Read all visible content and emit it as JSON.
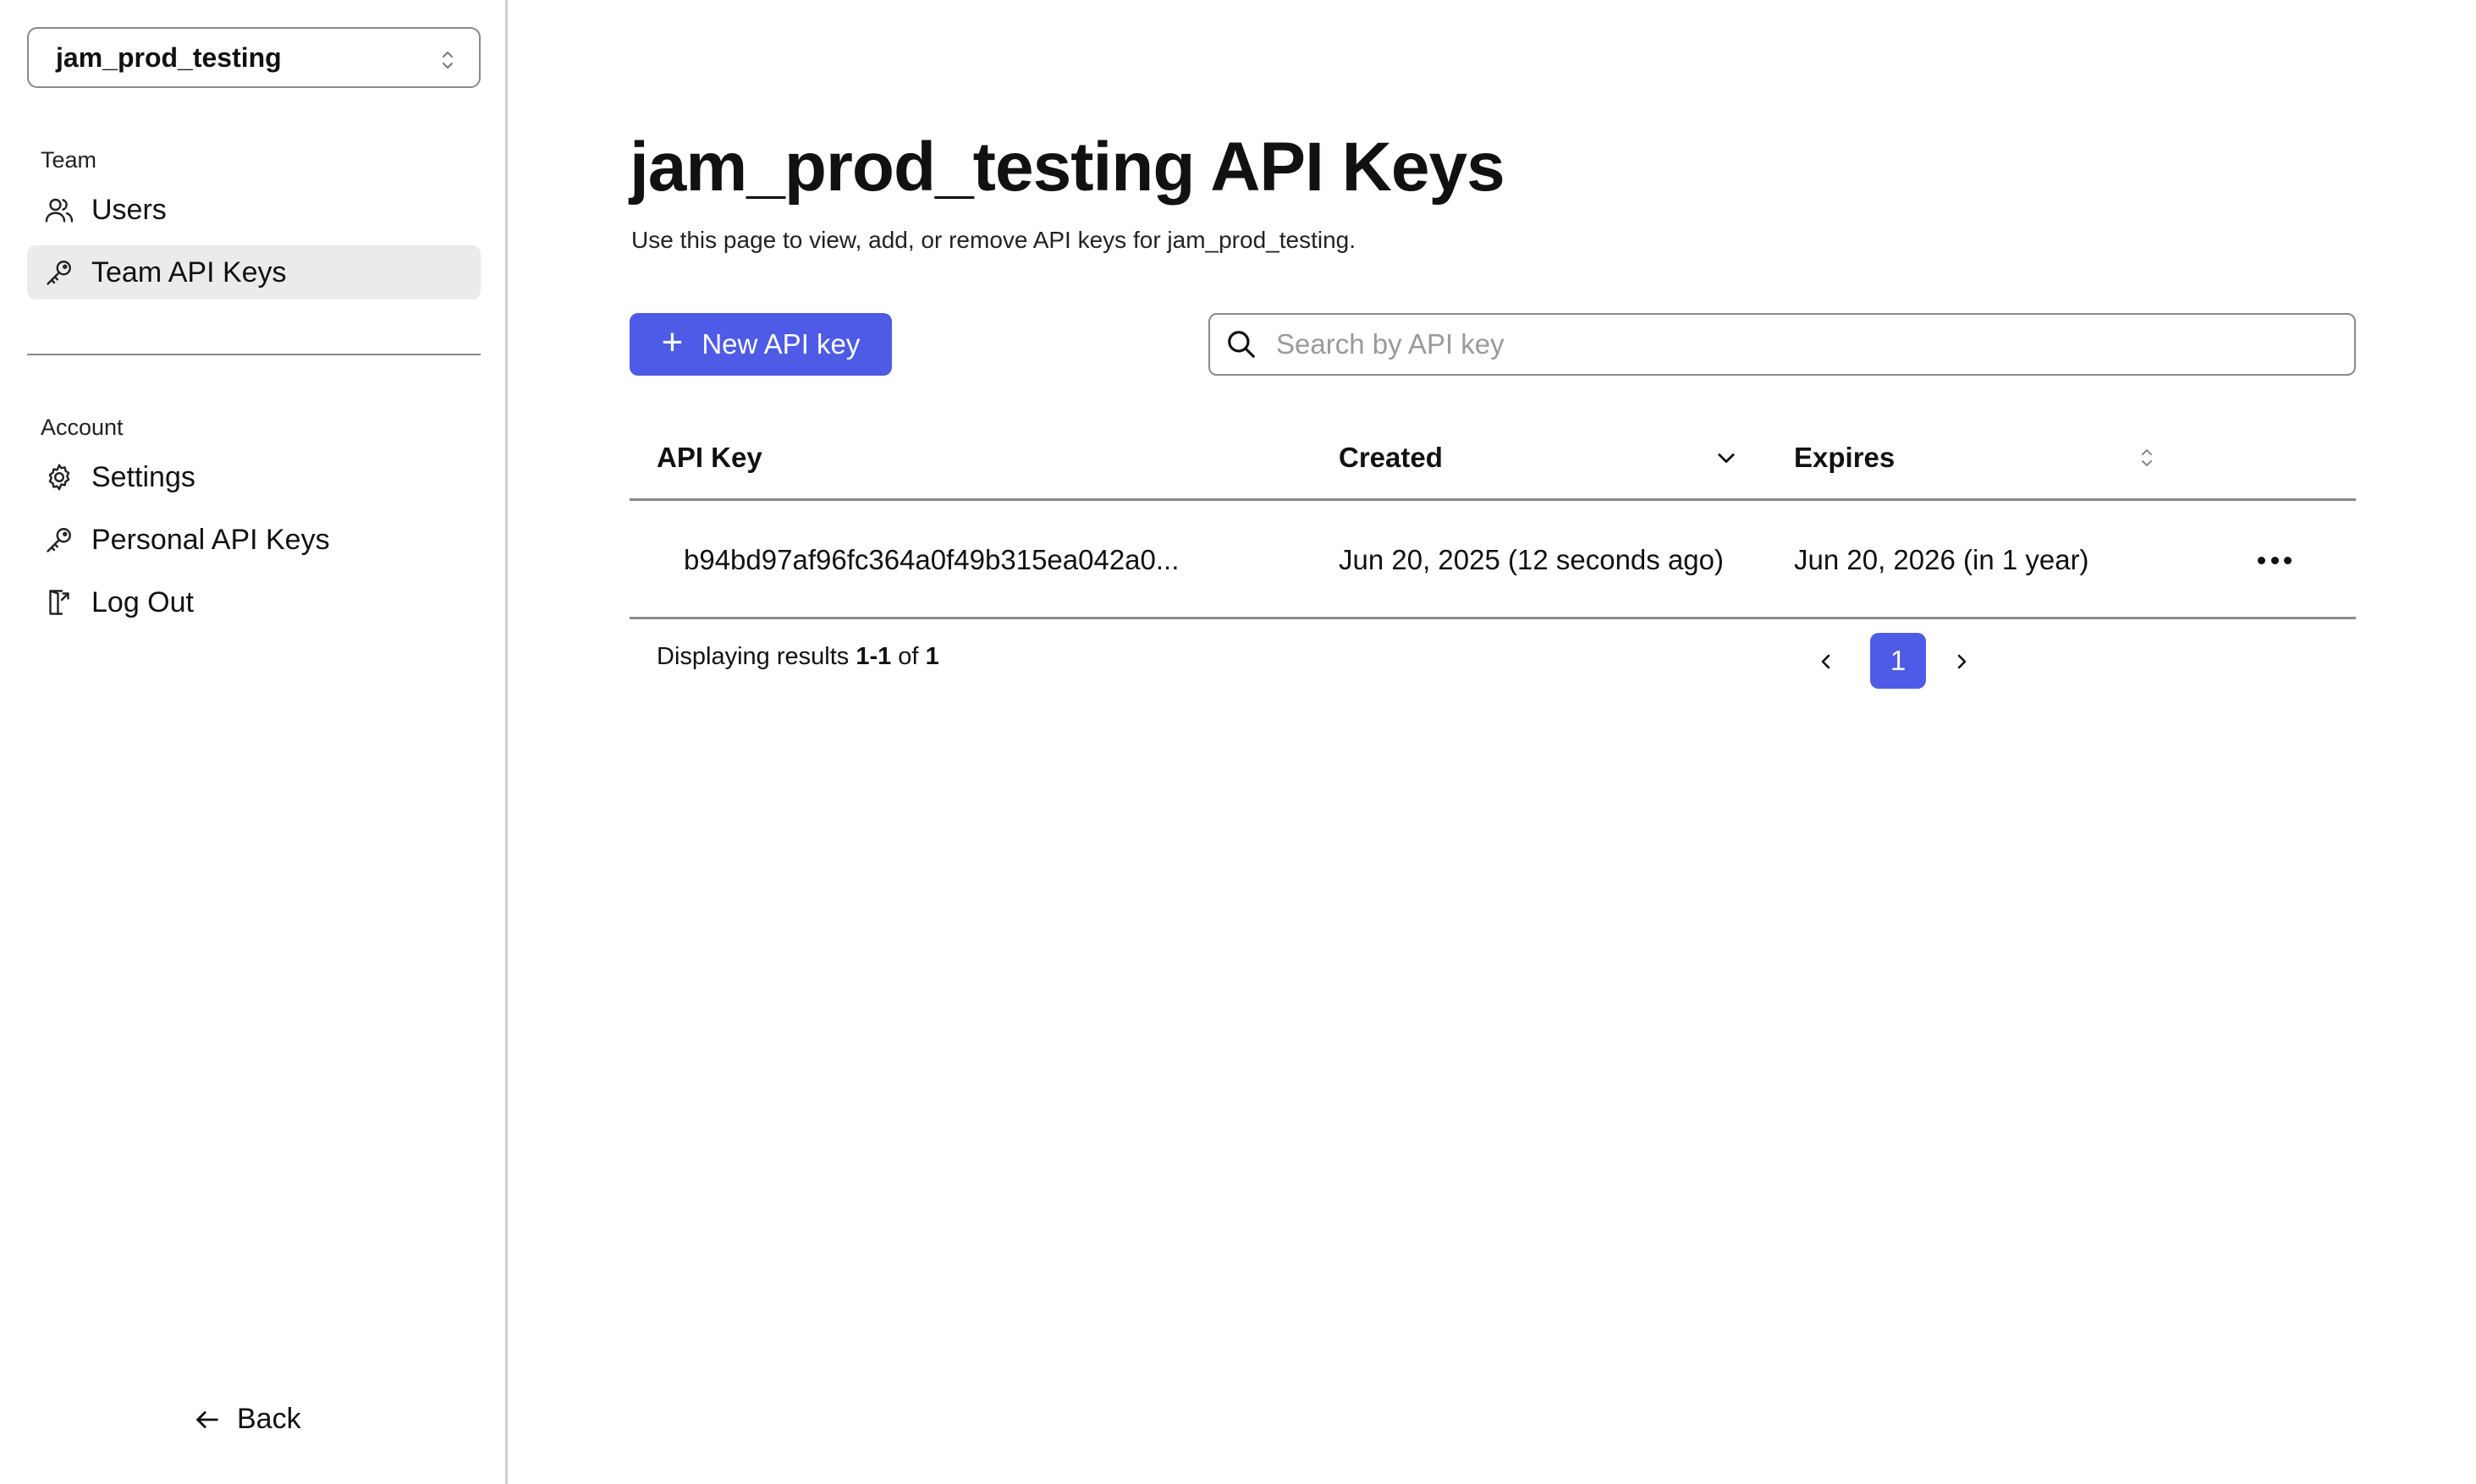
{
  "sidebar": {
    "team_selector": "jam_prod_testing",
    "team_section_label": "Team",
    "team_items": [
      {
        "label": "Users",
        "icon": "users-icon"
      },
      {
        "label": "Team API Keys",
        "icon": "key-icon",
        "active": true
      }
    ],
    "account_section_label": "Account",
    "account_items": [
      {
        "label": "Settings",
        "icon": "gear-icon"
      },
      {
        "label": "Personal API Keys",
        "icon": "key-icon"
      },
      {
        "label": "Log Out",
        "icon": "logout-icon"
      }
    ],
    "back_label": "Back"
  },
  "main": {
    "title": "jam_prod_testing API Keys",
    "subtitle": "Use this page to view, add, or remove API keys for jam_prod_testing.",
    "new_key_label": "New API key",
    "search_placeholder": "Search by API key",
    "search_value": ""
  },
  "table": {
    "columns": [
      "API Key",
      "Created",
      "Expires"
    ],
    "sort": {
      "created": "descending",
      "expires": "unsorted"
    },
    "rows": [
      {
        "api_key": "b94bd97af96fc364a0f49b315ea042a0...",
        "created": "Jun 20, 2025 (12 seconds ago)",
        "expires": "Jun 20, 2026 (in 1 year)"
      }
    ]
  },
  "pagination": {
    "prefix": "Displaying results ",
    "range": "1-1",
    "of": " of ",
    "total": "1",
    "current_page": "1"
  },
  "colors": {
    "accent": "#4e5be6",
    "active_nav_bg": "#ebebeb",
    "border": "#8a8a8a"
  }
}
